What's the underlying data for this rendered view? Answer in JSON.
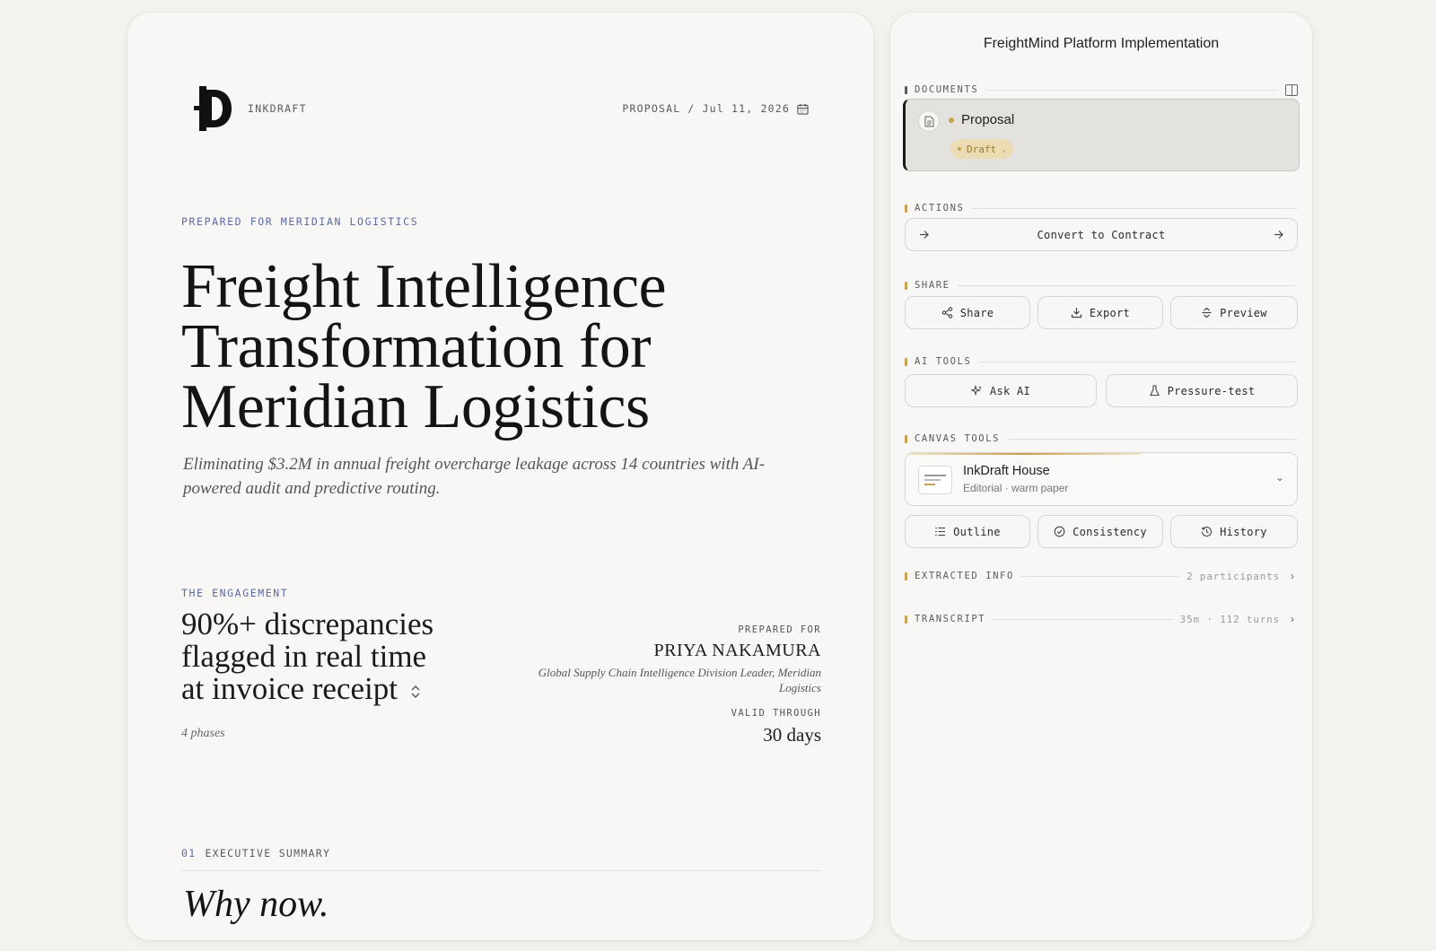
{
  "document": {
    "brand": "INKDRAFT",
    "meta_type": "PROPOSAL",
    "meta_sep": "/",
    "meta_date": "Jul 11, 2026",
    "prepared_for_line": "PREPARED FOR MERIDIAN LOGISTICS",
    "title_lines": [
      "Freight Intelligence",
      "Transformation for",
      "Meridian Logistics"
    ],
    "subtitle": "Eliminating $3.2M in annual freight overcharge leakage across 14 countries with AI-powered audit and predictive routing.",
    "engagement_label": "THE ENGAGEMENT",
    "big_stat_lines": [
      "90%+ discrepancies",
      "flagged in real time",
      "at invoice receipt"
    ],
    "phases": "4 phases",
    "prepared_for_label": "PREPARED FOR",
    "client_name": "PRIYA NAKAMURA",
    "client_role": "Global Supply Chain Intelligence Division Leader, Meridian Logistics",
    "valid_label": "VALID THROUGH",
    "valid_value": "30 days",
    "section_number": "01",
    "section_title": "EXECUTIVE SUMMARY",
    "section_heading": "Why now."
  },
  "panel": {
    "title": "FreightMind Platform Implementation",
    "documents_label": "DOCUMENTS",
    "doc_item": {
      "title": "Proposal",
      "status": "Draft"
    },
    "actions_label": "ACTIONS",
    "convert_label": "Convert to Contract",
    "share_label": "SHARE",
    "share_buttons": {
      "share": "Share",
      "export": "Export",
      "preview": "Preview"
    },
    "ai_label": "AI TOOLS",
    "ai_buttons": {
      "ask": "Ask AI",
      "pressure": "Pressure-test"
    },
    "canvas_label": "CANVAS TOOLS",
    "canvas_theme": {
      "title": "InkDraft House",
      "subtitle": "Editorial · warm paper"
    },
    "canvas_buttons": {
      "outline": "Outline",
      "consistency": "Consistency",
      "history": "History"
    },
    "extracted_label": "EXTRACTED INFO",
    "extracted_meta": "2 participants",
    "transcript_label": "TRANSCRIPT",
    "transcript_meta": "35m · 112 turns"
  },
  "colors": {
    "accent_blue": "#5b6aa8",
    "accent_gold": "#c8a14e",
    "draft_badge_bg": "#ecdcb4"
  },
  "icons": [
    "inkdraft-logo",
    "calendar-icon",
    "stepper-icon",
    "split-view-icon",
    "document-icon",
    "arrow-right-icon",
    "share-icon",
    "download-icon",
    "preview-icon",
    "sparkle-icon",
    "flask-icon",
    "chevron-down-icon",
    "list-icon",
    "check-circle-icon",
    "history-icon",
    "chevron-right-icon"
  ]
}
